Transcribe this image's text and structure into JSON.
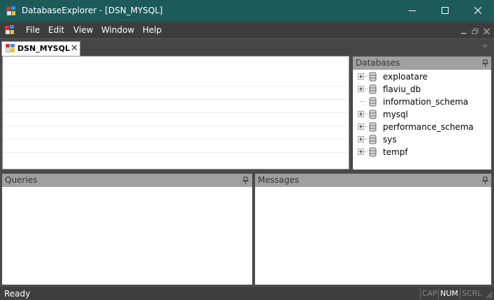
{
  "window": {
    "title": "DatabaseExplorer - [DSN_MYSQL]",
    "icons": {
      "app": "database-explorer-app-icon",
      "minimize": "minimize-icon",
      "maximize": "maximize-icon",
      "close": "close-icon"
    }
  },
  "menu": {
    "items": [
      "File",
      "Edit",
      "View",
      "Window",
      "Help"
    ],
    "icons": {
      "menu": "document-system-menu-icon",
      "mdi_minimize": "mdi-minimize-icon",
      "mdi_restore": "mdi-restore-icon",
      "mdi_close": "mdi-close-icon"
    }
  },
  "tabs": {
    "items": [
      {
        "label": "DSN_MYSQL",
        "close_glyph": "✕",
        "active": true
      }
    ],
    "icons": {
      "tab": "database-document-icon",
      "dropdown": "chevron-down-icon"
    }
  },
  "panels": {
    "databases": {
      "title": "Databases",
      "icon": "pin-icon"
    },
    "queries": {
      "title": "Queries",
      "icon": "pin-icon"
    },
    "messages": {
      "title": "Messages",
      "icon": "pin-icon"
    }
  },
  "databases": [
    {
      "name": "exploatare",
      "expandable": true
    },
    {
      "name": "flaviu_db",
      "expandable": true
    },
    {
      "name": "information_schema",
      "expandable": false
    },
    {
      "name": "mysql",
      "expandable": true
    },
    {
      "name": "performance_schema",
      "expandable": true
    },
    {
      "name": "sys",
      "expandable": true
    },
    {
      "name": "tempf",
      "expandable": true
    }
  ],
  "status": {
    "text": "Ready",
    "indicators": [
      {
        "label": "CAP",
        "active": false
      },
      {
        "label": "NUM",
        "active": true
      },
      {
        "label": "SCRL",
        "active": false
      }
    ]
  },
  "colors": {
    "titlebar": "#1d5b5b",
    "menubar": "#3d3d3d",
    "panel_header": "#a0a0a0",
    "workspace": "#4a4a4a",
    "statusbar": "#3f3f3f"
  }
}
